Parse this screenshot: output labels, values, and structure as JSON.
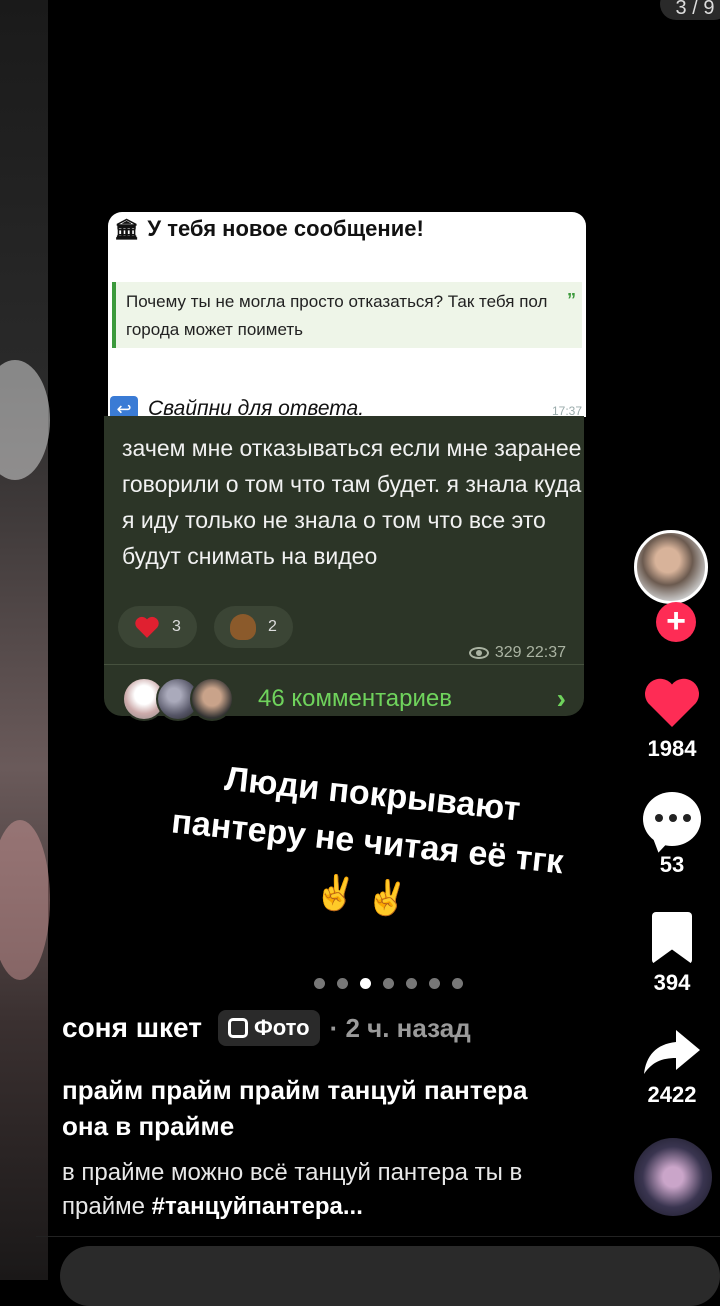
{
  "header": {
    "counter": "3 / 9"
  },
  "post": {
    "notification": {
      "title": "У тебя новое сообщение!",
      "quote": "Почему ты не могла просто отказаться? Так тебя пол города может поиметь",
      "swipe": "Свайпни для ответа.",
      "time": "17:37"
    },
    "message": {
      "text": "зачем мне отказываться если мне заранее говорили о том что там будет. я знала куда я иду только не знала о том что все это будут снимать на видео",
      "reactions": [
        {
          "icon": "heart-icon",
          "count": "3"
        },
        {
          "icon": "poop-icon",
          "count": "2"
        }
      ],
      "views": "329 22:37",
      "comments_label": "46 комментариев"
    },
    "overlay_text": "Люди покрывают пантеру не читая её тгк",
    "overlay_emojis": "✌️ ✌️",
    "carousel": {
      "total": 7,
      "active_index": 2
    }
  },
  "actions": {
    "likes": "1984",
    "comments": "53",
    "saves": "394",
    "shares": "2422"
  },
  "author": {
    "name": "соня шкет",
    "badge": "Фото",
    "time": "· 2 ч. назад"
  },
  "caption": {
    "title": "прайм прайм прайм танцуй пантера она в прайме",
    "text": "в прайме можно всё танцуй пантера ты в прайме",
    "hashtag": "#танцуйпантера..."
  },
  "colors": {
    "accent": "#fe2c55",
    "telegram_green": "#6fd35c",
    "bubble": "#2c3527"
  }
}
